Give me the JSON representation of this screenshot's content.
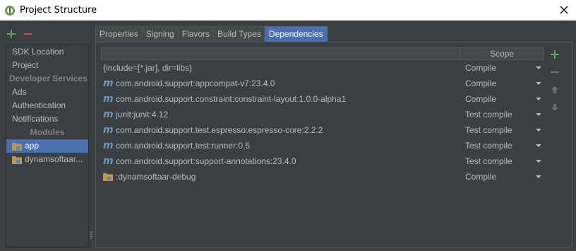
{
  "window": {
    "title": "Project Structure"
  },
  "toolbar": {
    "add_icon": "plus-icon",
    "remove_icon": "minus-icon",
    "add_color": "#59a869",
    "remove_color": "#c75450"
  },
  "sidebar": {
    "items_top": [
      {
        "label": "SDK Location"
      },
      {
        "label": "Project"
      }
    ],
    "section_dev": "Developer Services",
    "items_dev": [
      {
        "label": "Ads"
      },
      {
        "label": "Authentication"
      },
      {
        "label": "Notifications"
      }
    ],
    "section_modules": "Modules",
    "modules": [
      {
        "label": "app",
        "selected": true
      },
      {
        "label": "dynamsoftaar..."
      }
    ]
  },
  "tabs": [
    {
      "label": "Properties"
    },
    {
      "label": "Signing"
    },
    {
      "label": "Flavors"
    },
    {
      "label": "Build Types"
    },
    {
      "label": "Dependencies",
      "active": true
    }
  ],
  "table": {
    "header_scope": "Scope",
    "m_glyph": "m",
    "rows": [
      {
        "icon": "none",
        "name": "{include=[*.jar], dir=libs}",
        "scope": "Compile"
      },
      {
        "icon": "maven-icon",
        "name": "com.android.support:appcompat-v7:23.4.0",
        "scope": "Compile"
      },
      {
        "icon": "maven-icon",
        "name": "com.android.support.constraint:constraint-layout:1.0.0-alpha1",
        "scope": "Compile"
      },
      {
        "icon": "maven-icon",
        "name": "junit:junit:4.12",
        "scope": "Test compile"
      },
      {
        "icon": "maven-icon",
        "name": "com.android.support.test.espresso:espresso-core:2.2.2",
        "scope": "Test compile"
      },
      {
        "icon": "maven-icon",
        "name": "com.android.support.test:runner:0.5",
        "scope": "Test compile"
      },
      {
        "icon": "maven-icon",
        "name": "com.android.support:support-annotations:23.4.0",
        "scope": "Test compile"
      },
      {
        "icon": "module-folder-icon",
        "name": ":dynamsoftaar-debug",
        "scope": "Compile"
      }
    ]
  },
  "colors": {
    "background": "#3c3f41",
    "selection": "#4b6eaf",
    "maven": "#6897bb",
    "folder": "#c09553"
  }
}
